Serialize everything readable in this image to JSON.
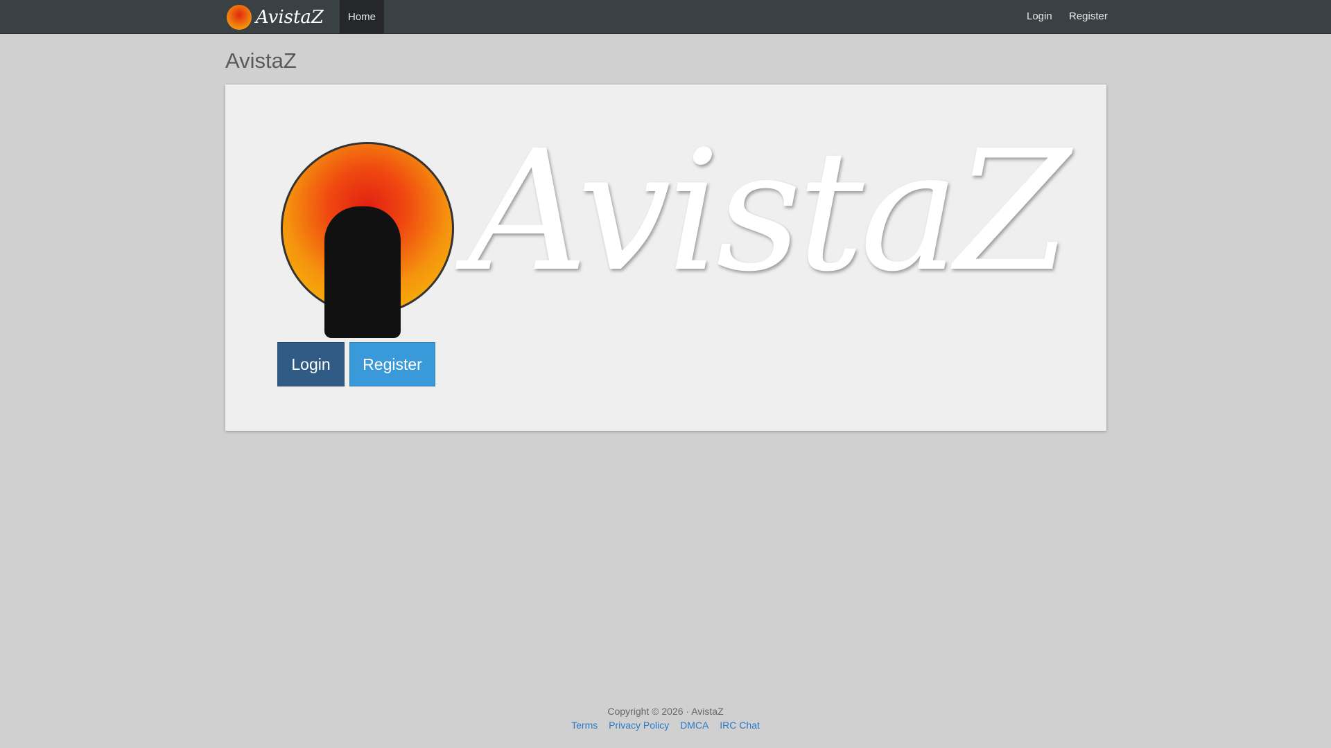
{
  "nav": {
    "brand": "AvistaZ",
    "home": "Home",
    "login": "Login",
    "register": "Register"
  },
  "page": {
    "title": "AvistaZ",
    "logo_text": "AvistaZ",
    "login_button": "Login",
    "register_button": "Register"
  },
  "footer": {
    "copyright": "Copyright © 2026 · AvistaZ",
    "links": [
      "Terms",
      "Privacy Policy",
      "DMCA",
      "IRC Chat"
    ]
  }
}
